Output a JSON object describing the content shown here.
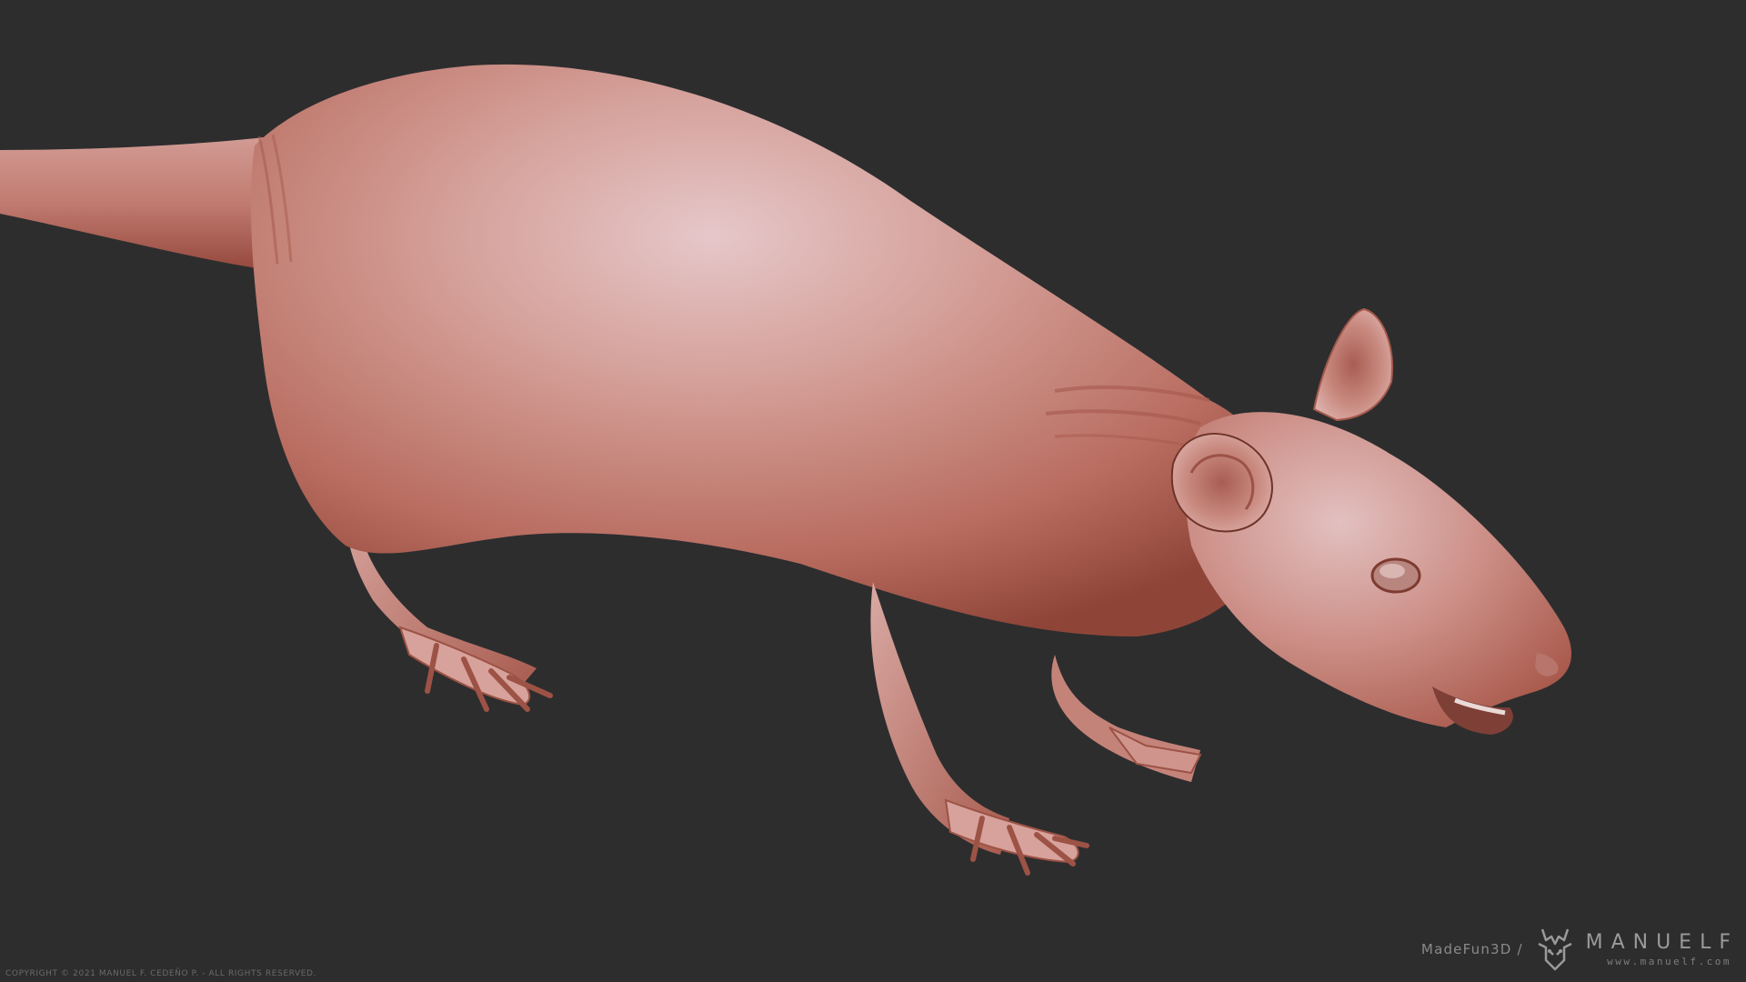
{
  "scene": {
    "background_color": "#2d2d2e",
    "clay_color": "#c98a80",
    "subject_icon": "rat-sculpt-icon"
  },
  "footer": {
    "copyright": "COPYRIGHT © 2021 MANUEL F. CEDEÑO P. - ALL RIGHTS RESERVED."
  },
  "watermark": {
    "studio": "MadeFun3D",
    "separator": "/",
    "brand": "MANUELF",
    "url": "www.manuelf.com",
    "logo_icon": "horned-skull-logo-icon"
  }
}
